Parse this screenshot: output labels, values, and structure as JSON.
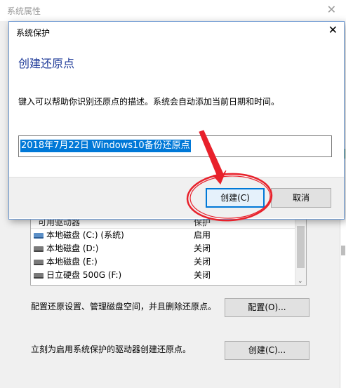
{
  "background_window": {
    "title": "系统属性",
    "close_glyph": "✕",
    "drive_list": {
      "header_left": "可用驱动器",
      "header_right": "保护",
      "rows": [
        {
          "name": "本地磁盘 (C:) (系统)",
          "status": "启用",
          "icon": "system-drive-icon"
        },
        {
          "name": "本地磁盘 (D:)",
          "status": "关闭",
          "icon": "drive-icon"
        },
        {
          "name": "本地磁盘 (E:)",
          "status": "关闭",
          "icon": "drive-icon"
        },
        {
          "name": "日立硬盘 500G (F:)",
          "status": "关闭",
          "icon": "drive-icon"
        }
      ],
      "scroll_down_glyph": "⌄"
    },
    "configure_text": "配置还原设置、管理磁盘空间，并且删除还原点。",
    "configure_button": "配置(O)...",
    "create_text": "立刻为启用系统保护的驱动器创建还原点。",
    "create_button": "创建(C)..."
  },
  "dialog": {
    "title": "系统保护",
    "close_glyph": "✕",
    "heading": "创建还原点",
    "description": "键入可以帮助你识别还原点的描述。系统会自动添加当前日期和时间。",
    "input_value": "2018年7月22日 Windows10备份还原点",
    "create_button": "创建(C)",
    "cancel_button": "取消"
  },
  "annotation": {
    "color": "#e8212b",
    "shape": "circle-and-arrow",
    "target": "create-button"
  },
  "colors": {
    "heading_blue": "#1f3b99",
    "selection_blue": "#0078d7",
    "default_button_border": "#0078d7"
  }
}
